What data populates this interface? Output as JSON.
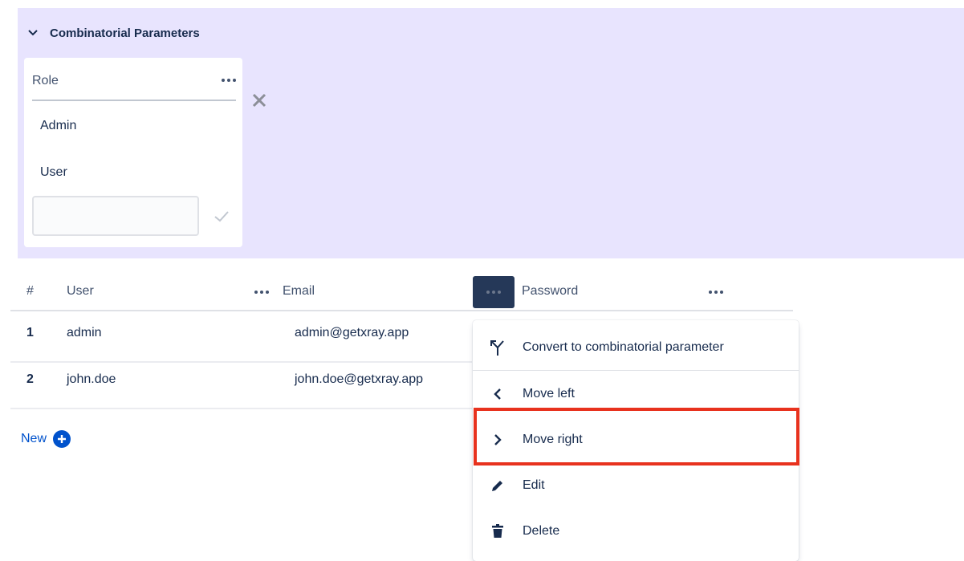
{
  "combinatorial": {
    "title": "Combinatorial Parameters",
    "parameter": {
      "name": "Role",
      "values": [
        "Admin",
        "User"
      ],
      "new_value_placeholder": ""
    }
  },
  "table": {
    "headers": {
      "index": "#",
      "col1": "User",
      "col2": "Email",
      "col3": "Password"
    },
    "rows": [
      {
        "num": "1",
        "user": "admin",
        "email": "admin@getxray.app"
      },
      {
        "num": "2",
        "user": "john.doe",
        "email": "john.doe@getxray.app"
      }
    ],
    "new_label": "New"
  },
  "context_menu": {
    "items": [
      {
        "label": "Convert to combinatorial parameter",
        "icon": "combinatorial-icon"
      },
      {
        "label": "Move left",
        "icon": "chevron-left-icon"
      },
      {
        "label": "Move right",
        "icon": "chevron-right-icon"
      },
      {
        "label": "Edit",
        "icon": "pencil-icon"
      },
      {
        "label": "Delete",
        "icon": "trash-icon"
      }
    ]
  },
  "colors": {
    "panel_background": "#e8e4fe",
    "accent": "#0052cc",
    "highlight": "#e8321e",
    "active_button": "#253858"
  }
}
